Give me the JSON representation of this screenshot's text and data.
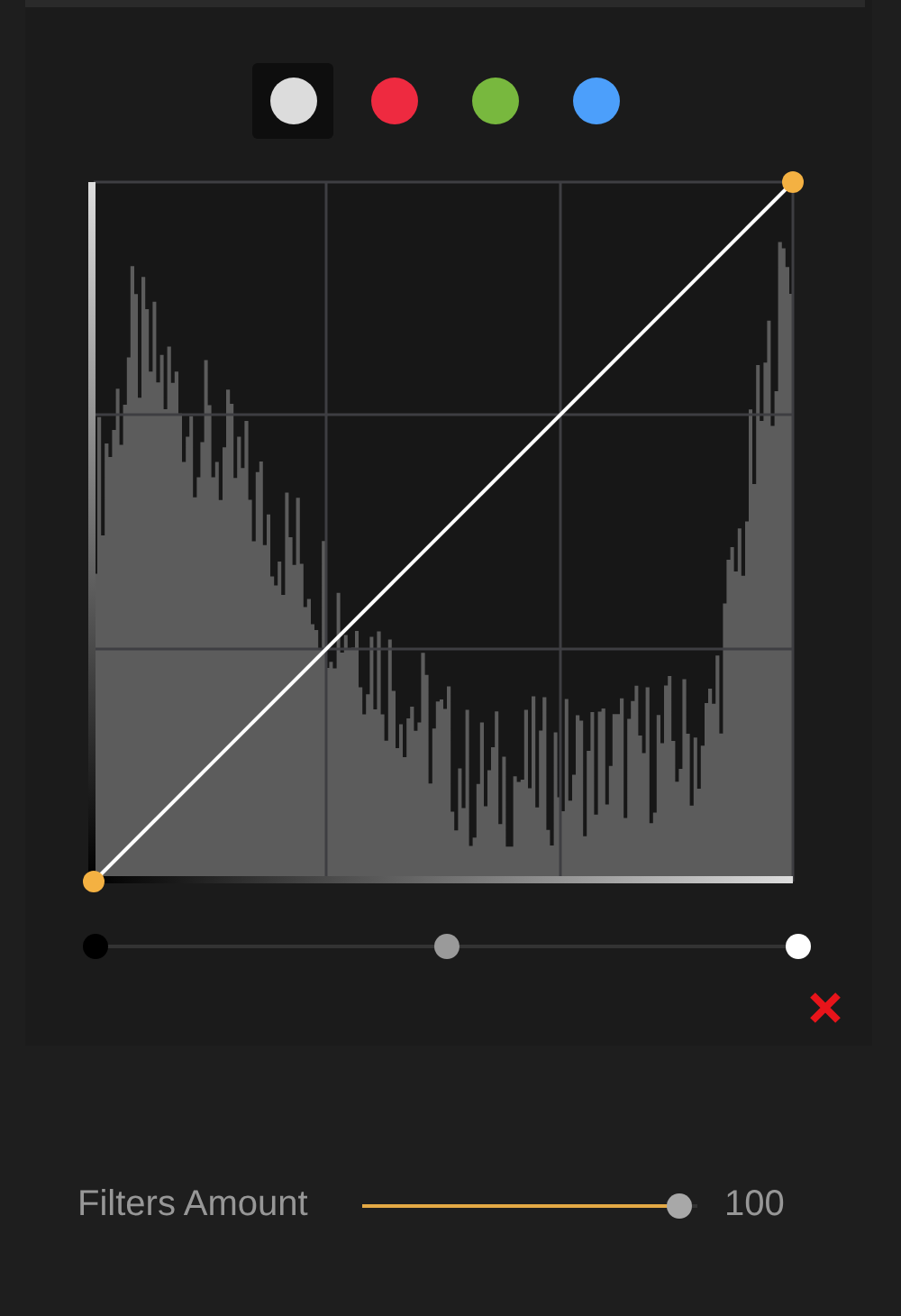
{
  "channels": [
    {
      "color": "#dcdcdc",
      "selected": true
    },
    {
      "color": "#ee2a40",
      "selected": false
    },
    {
      "color": "#78b83e",
      "selected": false
    },
    {
      "color": "#4c9ffb",
      "selected": false
    }
  ],
  "input_levels": [
    {
      "color": "#000000",
      "level": 0
    },
    {
      "color": "#9a9a9a",
      "level": 0.5
    },
    {
      "color": "#ffffff",
      "level": 1
    }
  ],
  "filters_amount": {
    "label": "Filters Amount",
    "level": 0.98,
    "value": "100"
  }
}
